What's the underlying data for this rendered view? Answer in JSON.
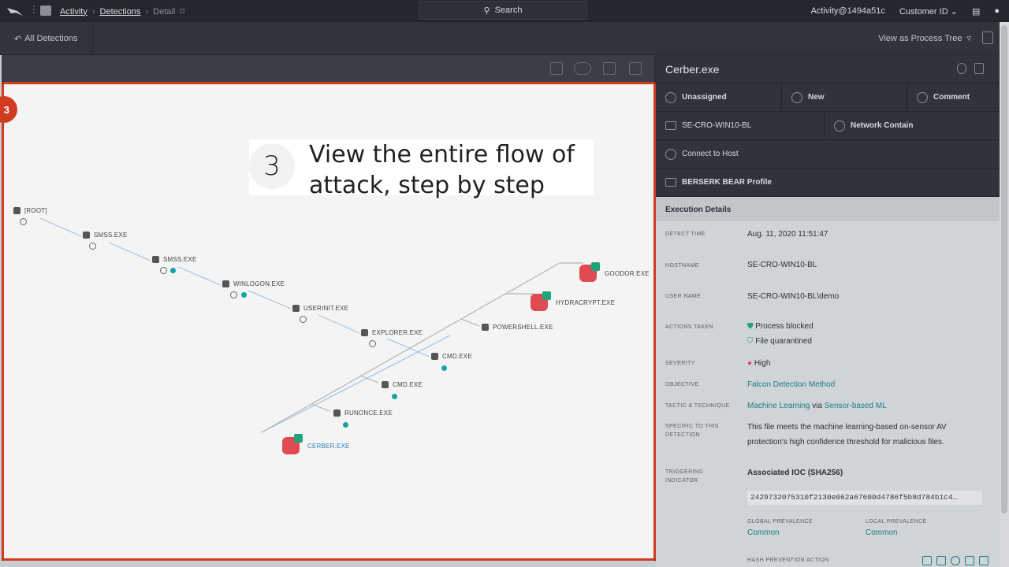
{
  "topbar": {
    "breadcrumbs": [
      "Activity",
      "Detections",
      "Detail"
    ],
    "search_label": "Search",
    "user": "Activity@1494a51c",
    "customer": "Customer ID"
  },
  "subbar": {
    "back_label": "All Detections",
    "view_label": "View as Process Tree"
  },
  "callout": {
    "number": "3",
    "line1": "View the entire flow of",
    "line2": "attack, step by step"
  },
  "step_badge": "3",
  "tree": {
    "nodes": [
      "[ROOT]",
      "SMSS.EXE",
      "SMSS.EXE",
      "WINLOGON.EXE",
      "USERINIT.EXE",
      "EXPLORER.EXE",
      "CMD.EXE",
      "CMD.EXE",
      "RUNONCE.EXE",
      "CERBER.EXE",
      "POWERSHELL.EXE",
      "HYDRACRYPT.EXE",
      "GOODOR.EXE"
    ]
  },
  "panel": {
    "title": "Cerber.exe",
    "actions": {
      "unassigned": "Unassigned",
      "new": "New",
      "comment": "Comment",
      "host": "SE-CRO-WIN10-BL",
      "network_contain": "Network Contain",
      "connect": "Connect to Host",
      "profile": "BERSERK BEAR Profile"
    },
    "exec_title": "Execution Details",
    "details": {
      "detect_time_label": "DETECT TIME",
      "detect_time": "Aug. 11, 2020 11:51:47",
      "hostname_label": "HOSTNAME",
      "hostname": "SE-CRO-WIN10-BL",
      "username_label": "USER NAME",
      "username": "SE-CRO-WIN10-BL\\demo",
      "actions_label": "ACTIONS TAKEN",
      "action1": "Process blocked",
      "action2": "File quarantined",
      "severity_label": "SEVERITY",
      "severity": "High",
      "objective_label": "OBJECTIVE",
      "objective": "Falcon Detection Method",
      "tactic_label": "TACTIC & TECHNIQUE",
      "tactic1": "Machine Learning",
      "tactic_via": "via",
      "tactic2": "Sensor-based ML",
      "specific_label1": "SPECIFIC TO THIS",
      "specific_label2": "DETECTION",
      "specific1": "This file meets the machine learning-based on-sensor AV",
      "specific2": "protection's high confidence threshold for malicious files.",
      "trigger_label1": "TRIGGERING",
      "trigger_label2": "INDICATOR",
      "ioc_title": "Associated IOC (SHA256)",
      "ioc": "2429732075310f2130e062a67600d4786f5b8d784b1c4…",
      "global_label": "GLOBAL PREVALENCE",
      "global": "Common",
      "local_label": "LOCAL PREVALENCE",
      "local": "Common",
      "hash_label": "HASH PREVENTION ACTION"
    }
  }
}
